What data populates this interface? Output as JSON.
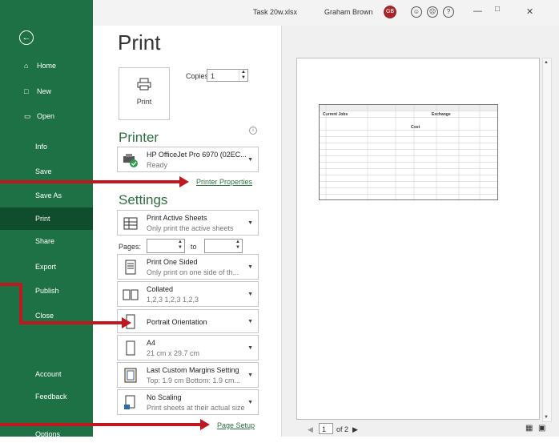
{
  "window": {
    "filename": "Task 20w.xlsx",
    "user_name": "Graham Brown",
    "user_initials": "GB"
  },
  "sidebar": {
    "back_glyph": "←",
    "nav": [
      {
        "icon": "⌂",
        "label": "Home"
      },
      {
        "icon": "□",
        "label": "New"
      },
      {
        "icon": "▭",
        "label": "Open"
      }
    ],
    "items": [
      "Info",
      "Save",
      "Save As",
      "Print",
      "Share",
      "Export",
      "Publish",
      "Close"
    ],
    "bottom": [
      "Account",
      "Feedback",
      "Options"
    ],
    "active": "Print"
  },
  "print": {
    "title": "Print",
    "button_label": "Print",
    "copies_label": "Copies:",
    "copies_value": "1"
  },
  "printer": {
    "heading": "Printer",
    "name": "HP OfficeJet Pro 6970 (02EC...",
    "status": "Ready",
    "properties_link": "Printer Properties"
  },
  "settings": {
    "heading": "Settings",
    "active_sheets": {
      "title": "Print Active Sheets",
      "subtitle": "Only print the active sheets"
    },
    "pages_label": "Pages:",
    "to_label": "to",
    "sided": {
      "title": "Print One Sided",
      "subtitle": "Only print on one side of th..."
    },
    "collated": {
      "title": "Collated",
      "subtitle": "1,2,3   1,2,3   1,2,3"
    },
    "orientation": {
      "title": "Portrait Orientation"
    },
    "paper": {
      "title": "A4",
      "subtitle": "21 cm x 29.7 cm"
    },
    "margins": {
      "title": "Last Custom Margins Setting",
      "subtitle": "Top: 1.9 cm Bottom: 1.9 cm..."
    },
    "scaling": {
      "title": "No Scaling",
      "subtitle": "Print sheets at their actual size"
    },
    "page_setup_link": "Page Setup"
  },
  "preview": {
    "page_current": "1",
    "page_of": "of 2",
    "sheet_title": "Current Jobs",
    "exchange_label": "Exchange",
    "cost_label": "Cost"
  },
  "colors": {
    "sidebar": "#1e7145",
    "sidebar_active": "#0f4d2c",
    "accent_link": "#2e6f40",
    "arrow": "#c0181f"
  }
}
